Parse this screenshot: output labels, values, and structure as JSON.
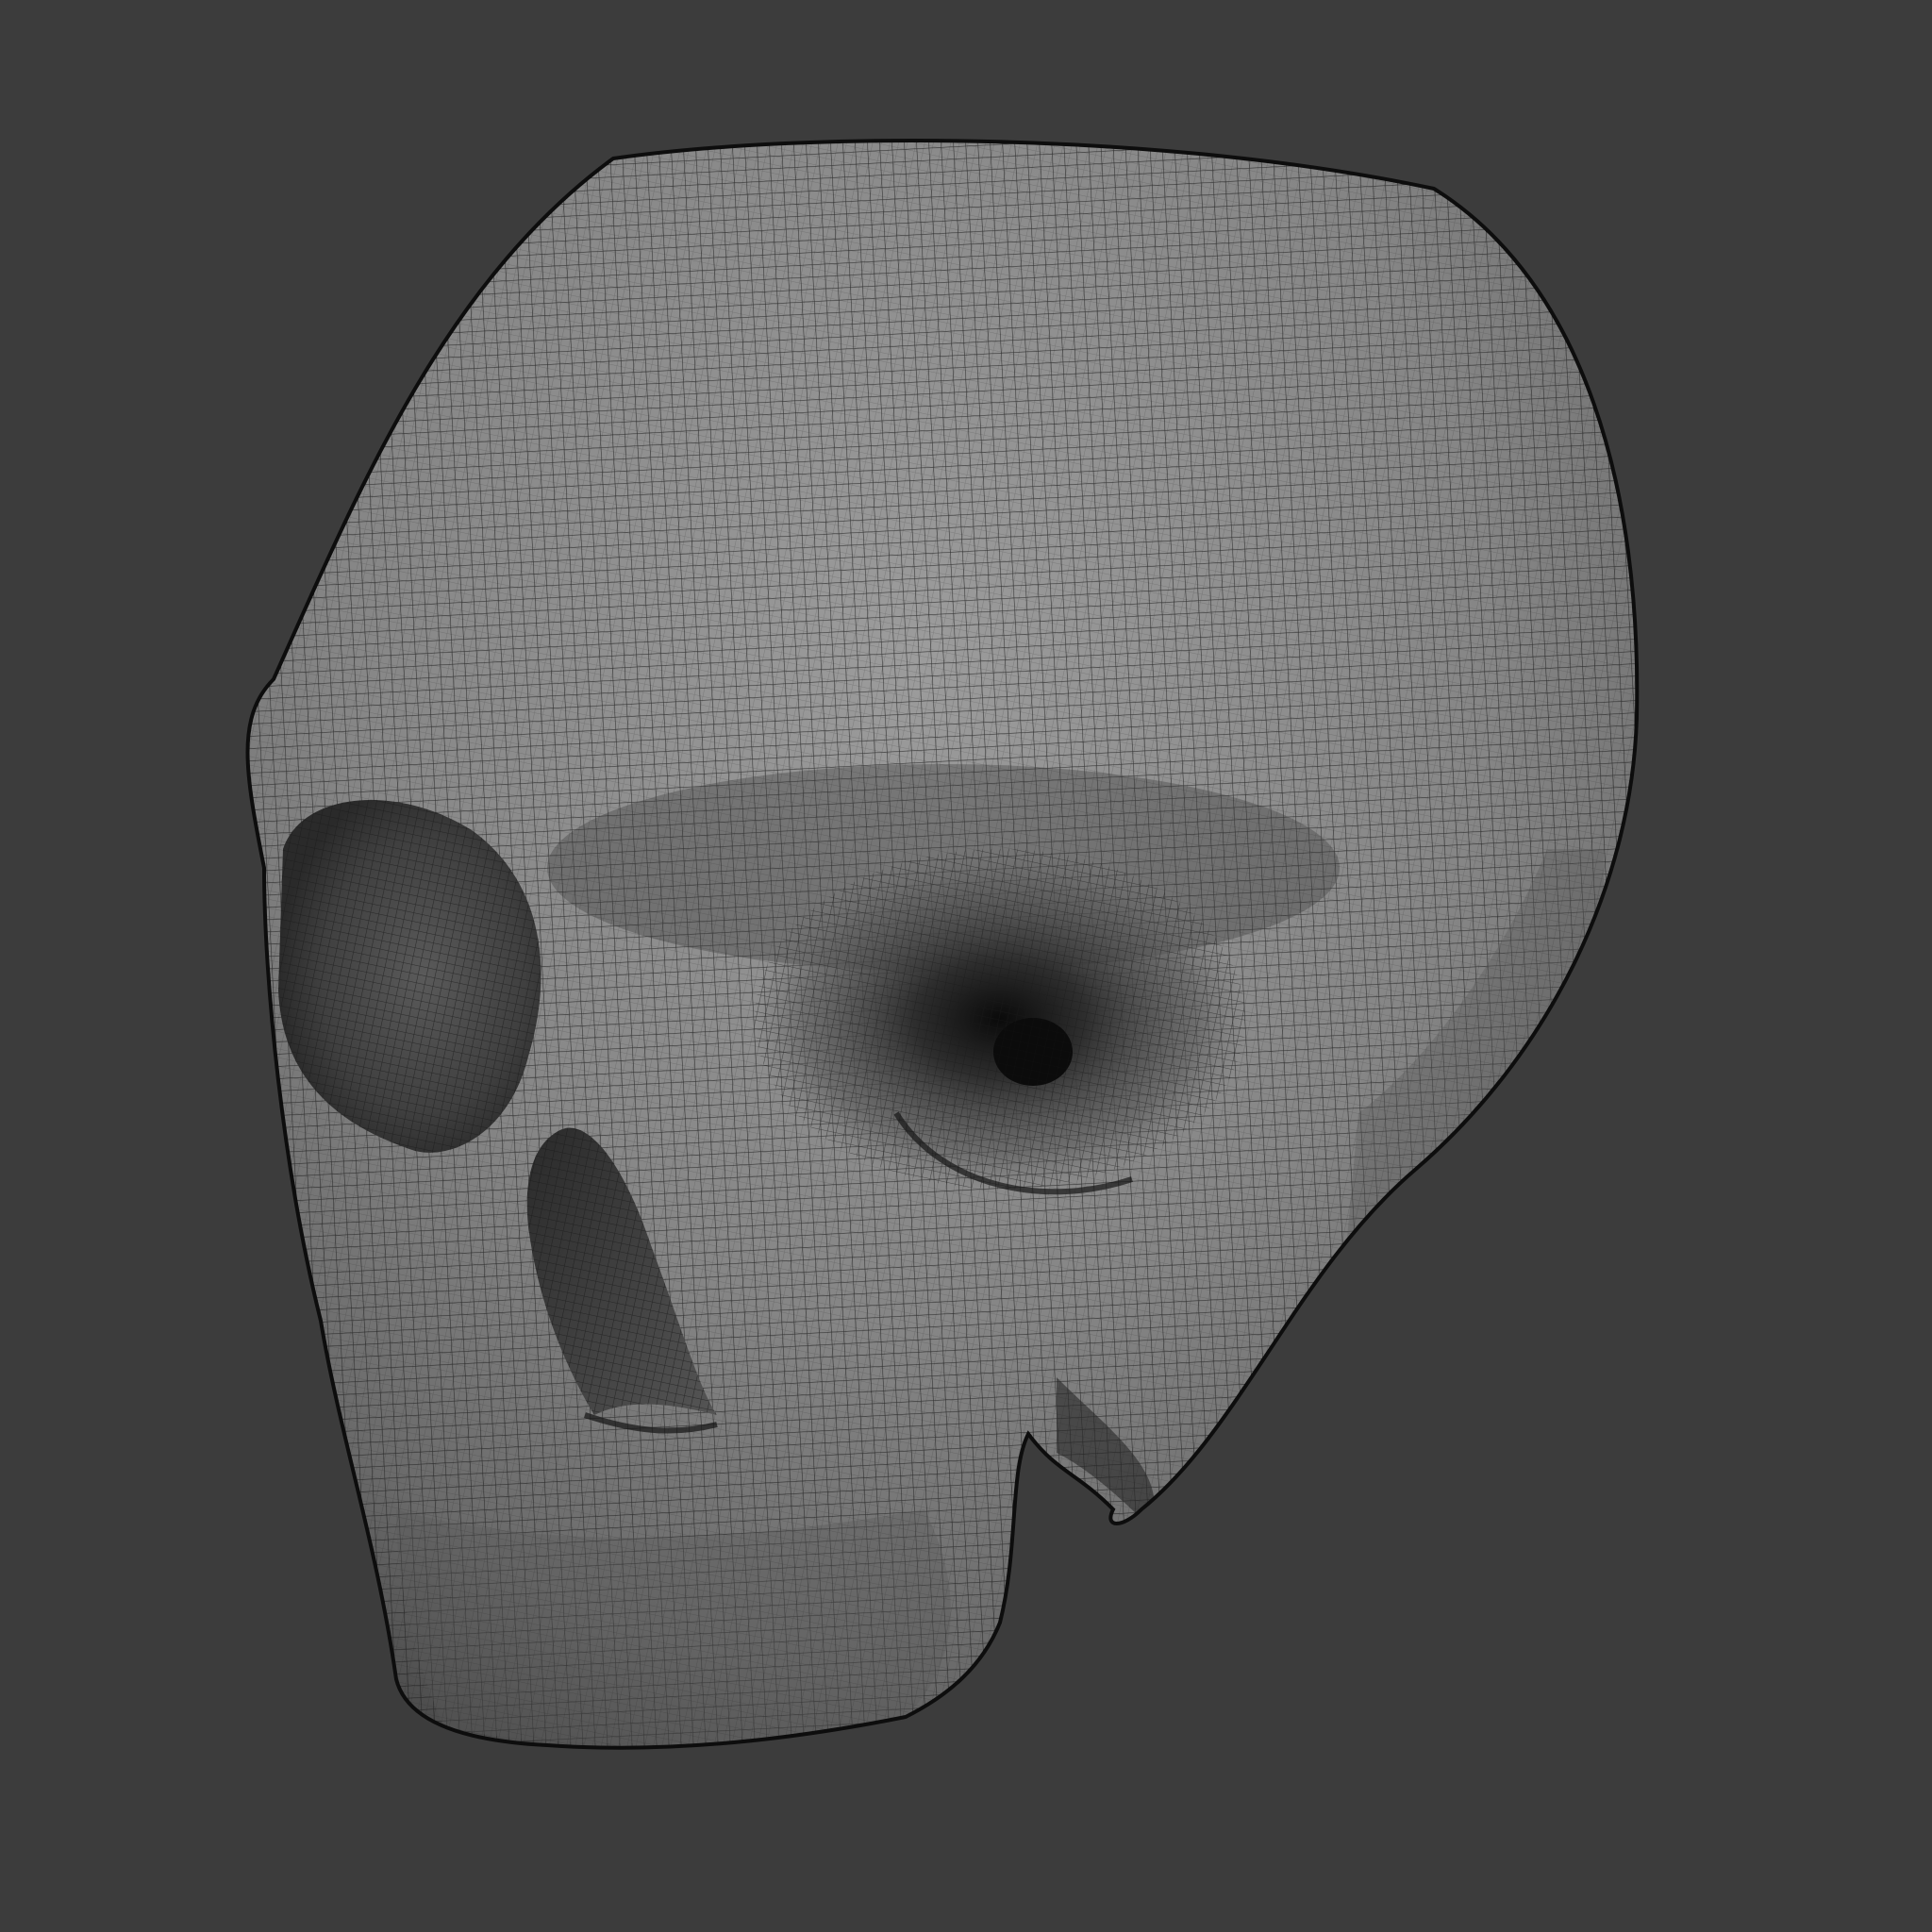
{
  "scene": {
    "subject": "skull-wireframe",
    "background_color": "#3c3c3c",
    "surface_color": "#8c8c8c",
    "wire_color": "#1e1e1e",
    "outline_color": "#0d0d0d",
    "shadow_color": "#141414"
  }
}
